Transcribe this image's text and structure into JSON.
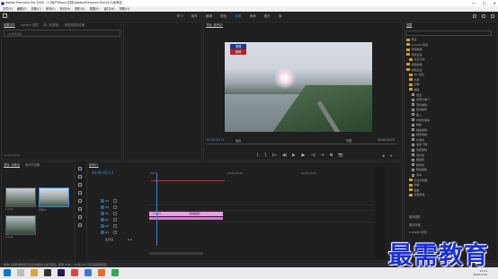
{
  "window": {
    "title": "Adobe Premiere Pro 2020 - C:\\用户\\Eboy\\文档\\Adobe\\Premiere Pro\\14.0\\未命名",
    "controls": [
      "—",
      "□",
      "✕"
    ]
  },
  "menu": [
    "文件(F)",
    "编辑(E)",
    "剪辑(C)",
    "序列(S)",
    "标记(M)",
    "图形(G)",
    "视图(V)",
    "窗口(W)",
    "帮助(H)"
  ],
  "workspaces": {
    "tabs": [
      "学习",
      "组件",
      "编辑",
      "颜色",
      "效果",
      "音频",
      "图形",
      "库"
    ],
    "active_index": 4
  },
  "source_panel": {
    "tabs": [
      "效果控件",
      "Lumetri 范围",
      "源: (无剪辑)",
      "音频剪辑混合器"
    ],
    "empty_label": "(未选择剪辑)",
    "footer": "00:00:00:00"
  },
  "program_monitor": {
    "tab": "节目: 序列01",
    "logo_top": "央视",
    "logo_bottom": "新闻",
    "timecode": "00:00:00:11",
    "fit": "适合",
    "resolution": "完整",
    "duration": "00:00:04:07",
    "transport": [
      "{",
      "}",
      "|←",
      "◀|",
      "▶",
      "|▶",
      "→|",
      "⇥",
      "⊞",
      "📷"
    ],
    "transport_right": [
      "⊕",
      "+"
    ]
  },
  "effects_panel": {
    "tab": "效果",
    "items": [
      {
        "label": "预设",
        "kind": "folder"
      },
      {
        "label": "Lumetri 预设",
        "kind": "folder"
      },
      {
        "label": "音频效果",
        "kind": "folder"
      },
      {
        "label": "音频过渡",
        "kind": "folder"
      },
      {
        "label": "交叉淡化",
        "kind": "folder"
      },
      {
        "label": "视频效果",
        "kind": "folder"
      },
      {
        "label": "视频过渡",
        "kind": "folder"
      },
      {
        "label": "3D 运动",
        "kind": "folder"
      },
      {
        "label": "内滑",
        "kind": "folder"
      },
      {
        "label": "划像",
        "kind": "folder"
      },
      {
        "label": "擦除",
        "kind": "folder"
      },
      {
        "label": "划出",
        "kind": "item"
      },
      {
        "label": "双侧平推门",
        "kind": "item"
      },
      {
        "label": "带状擦除",
        "kind": "item"
      },
      {
        "label": "径向擦除",
        "kind": "item"
      },
      {
        "label": "插入",
        "kind": "item"
      },
      {
        "label": "时钟式擦除",
        "kind": "item"
      },
      {
        "label": "棋盘",
        "kind": "item"
      },
      {
        "label": "棋盘擦除",
        "kind": "item"
      },
      {
        "label": "楔形擦除",
        "kind": "item"
      },
      {
        "label": "水波块",
        "kind": "item"
      },
      {
        "label": "油漆飞溅",
        "kind": "item"
      },
      {
        "label": "渐变擦除",
        "kind": "item"
      },
      {
        "label": "百叶窗",
        "kind": "item"
      },
      {
        "label": "螺旋框",
        "kind": "item"
      },
      {
        "label": "随机块",
        "kind": "item"
      },
      {
        "label": "随机擦除",
        "kind": "item"
      },
      {
        "label": "风车",
        "kind": "item"
      },
      {
        "label": "沉浸式视频",
        "kind": "folder"
      },
      {
        "label": "溶解",
        "kind": "folder"
      },
      {
        "label": "缩放",
        "kind": "folder"
      },
      {
        "label": "页面剥落",
        "kind": "folder"
      }
    ],
    "lower_panels": [
      "基本图形",
      "基本声音",
      "Lumetri 颜色"
    ]
  },
  "project_panel": {
    "tabs": [
      "项目: 未命名",
      "媒体浏览器"
    ],
    "search_placeholder": "",
    "thumbs": [
      {
        "label": "1.mp4",
        "dur": "4:07"
      },
      {
        "label": "序列01",
        "dur": "4:07"
      },
      {
        "label": "2.mp4",
        "dur": "4:07"
      }
    ]
  },
  "timeline": {
    "tab": "序列01",
    "timecode": "00:00:00:11",
    "ruler": [
      "00:00",
      "00:00:05:00",
      "00:00:10:00"
    ],
    "tracks": [
      {
        "name": "V3"
      },
      {
        "name": "V2"
      },
      {
        "name": "V1"
      },
      {
        "name": "A1"
      },
      {
        "name": "A2"
      },
      {
        "name": "A3"
      }
    ],
    "master": "主声道",
    "master_value": "0.0",
    "clip_label": "1.mp4",
    "clip_label2": "2.mp4"
  },
  "status_bar": "单击以选择,或单击空白处并拖动以进行框选。使用 Shift、Alt 和 Ctrl 可获得其他选项。",
  "taskbar": {
    "time": "11:21",
    "date": "2021/11/9"
  },
  "watermark": "最需教育",
  "colors": {
    "accent": "#2d8ceb",
    "clip": "#e69fe3",
    "watermark": "#1a2fd8"
  }
}
